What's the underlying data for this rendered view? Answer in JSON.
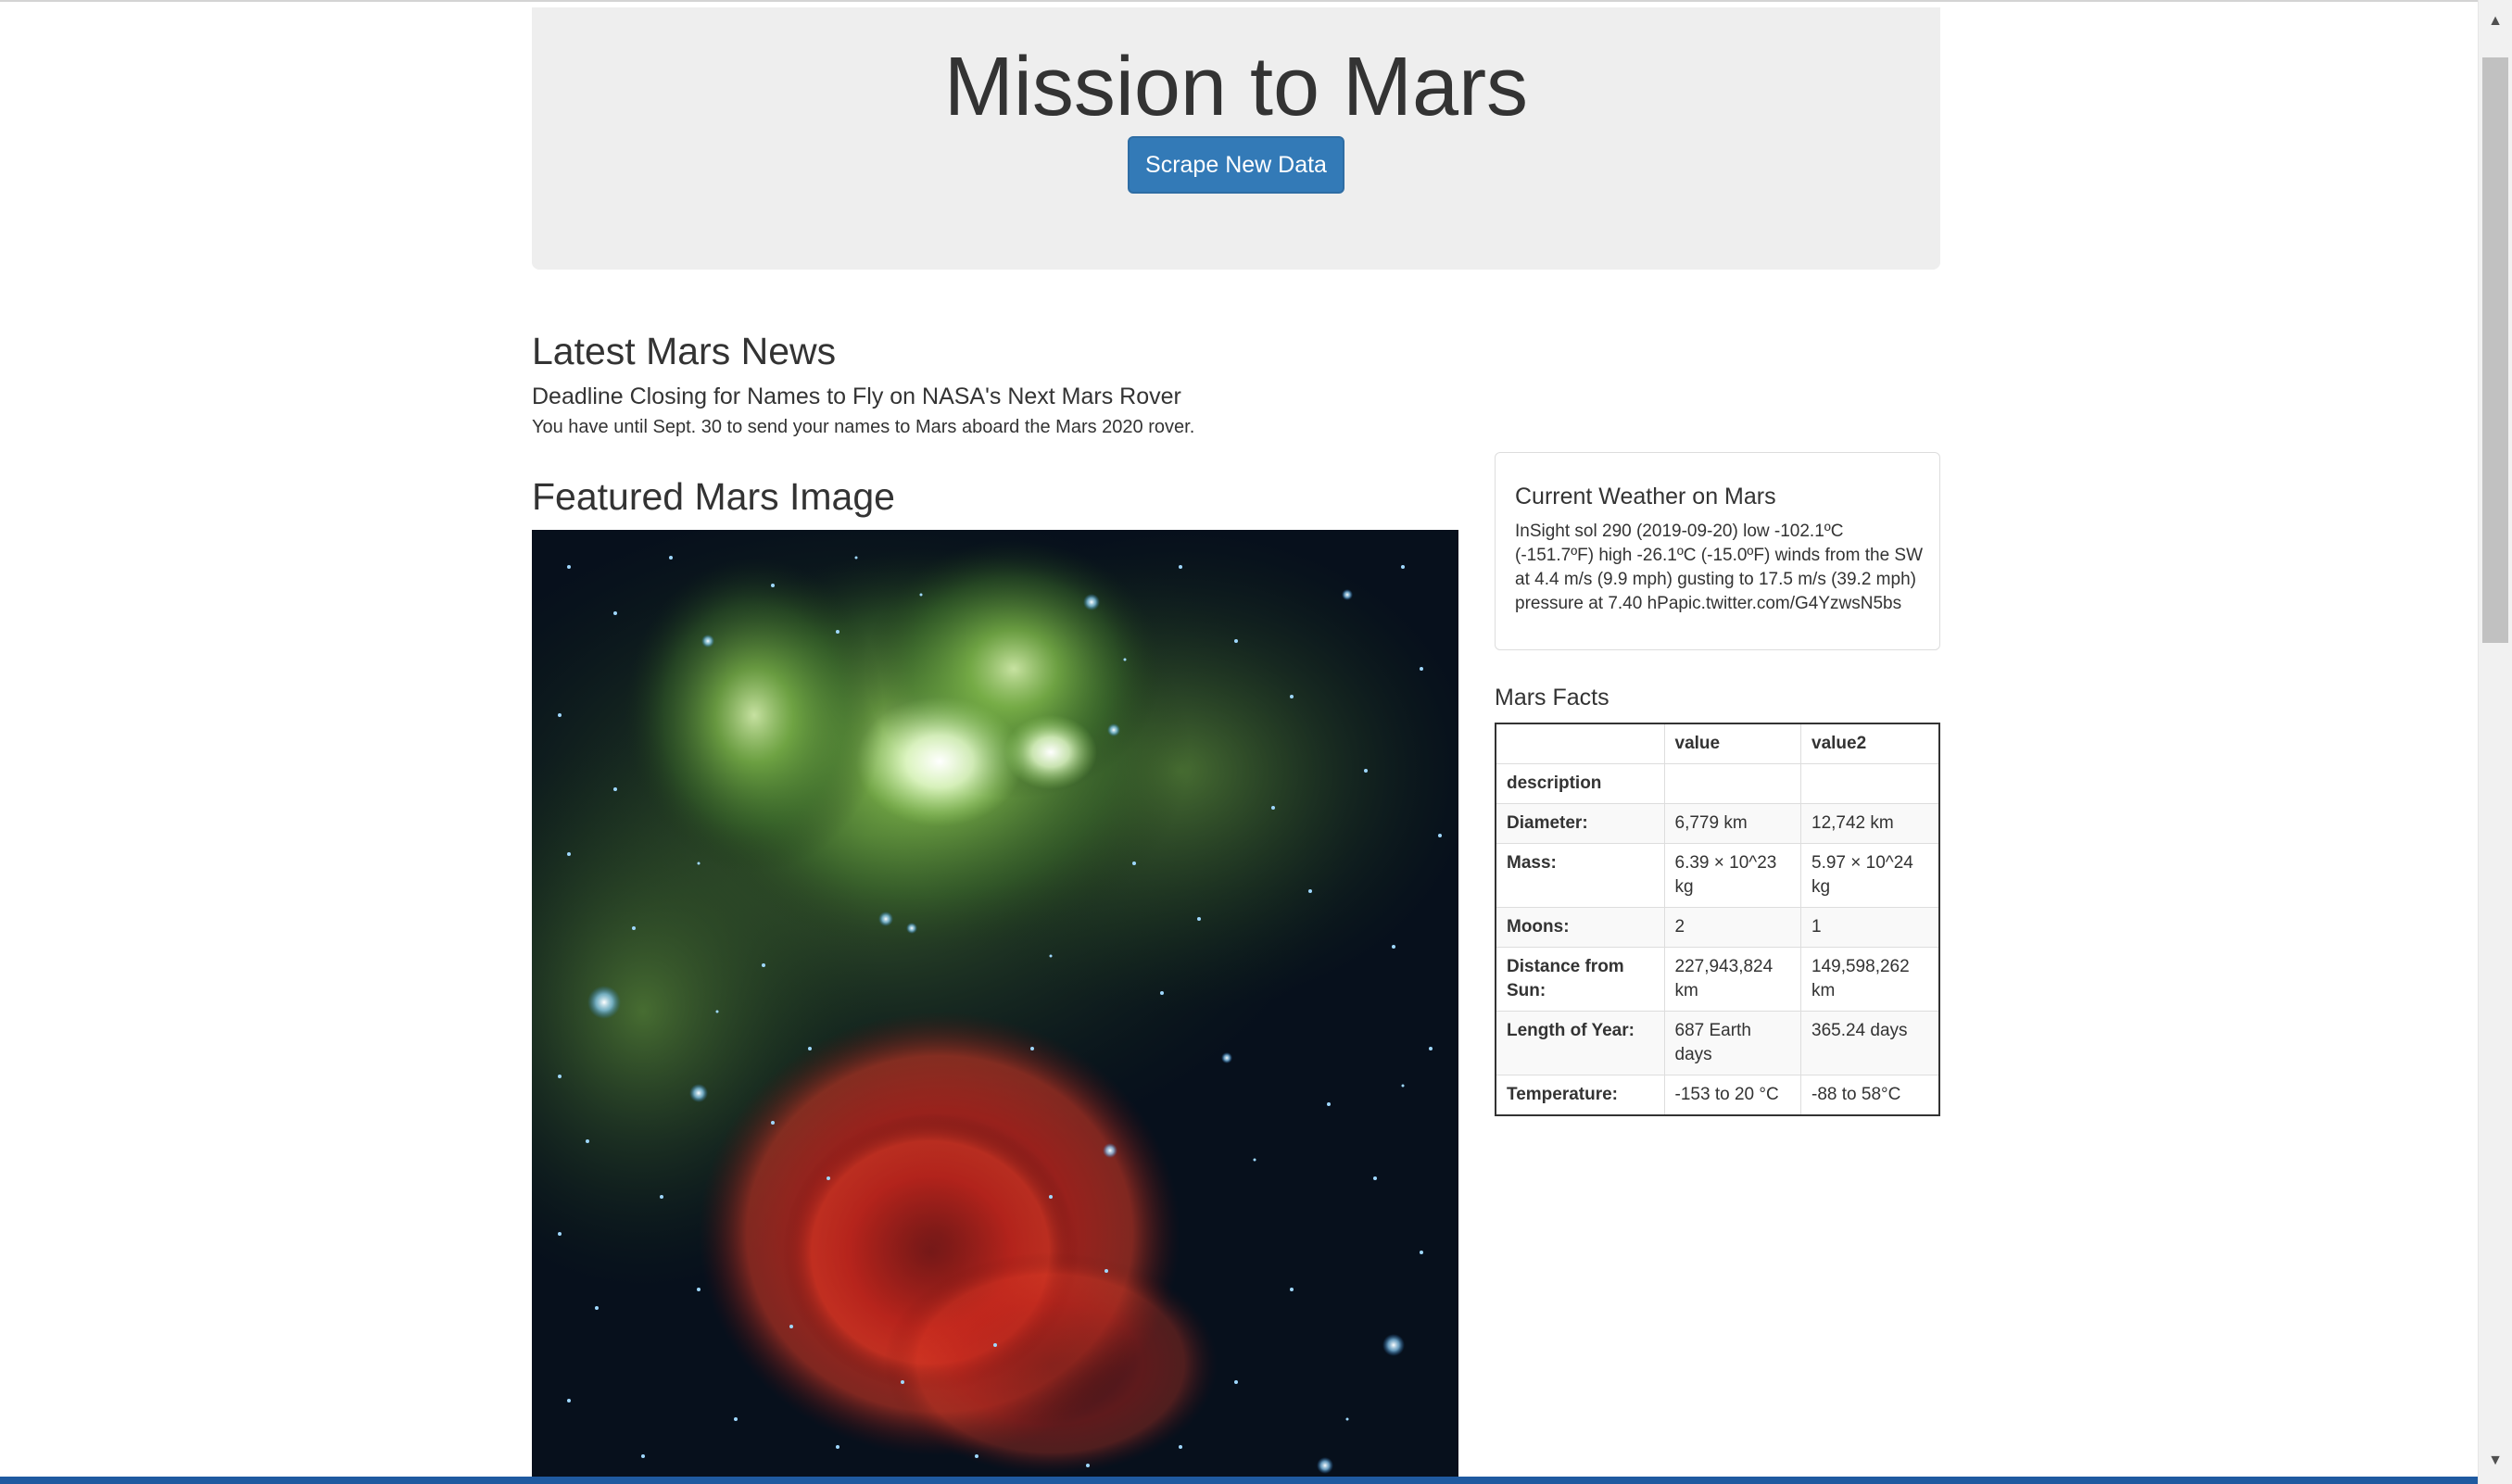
{
  "header": {
    "title": "Mission to Mars",
    "scrape_button_label": "Scrape New Data"
  },
  "news": {
    "section_title": "Latest Mars News",
    "headline": "Deadline Closing for Names to Fly on NASA's Next Mars Rover",
    "teaser": "You have until Sept. 30 to send your names to Mars aboard the Mars 2020 rover."
  },
  "featured": {
    "section_title": "Featured Mars Image"
  },
  "weather": {
    "title": "Current Weather on Mars",
    "text": "InSight sol 290 (2019-09-20) low -102.1ºC (-151.7ºF) high -26.1ºC (-15.0ºF) winds from the SW at 4.4 m/s (9.9 mph) gusting to 17.5 m/s (39.2 mph) pressure at 7.40 hPapic.twitter.com/G4YzwsN5bs"
  },
  "facts": {
    "title": "Mars Facts",
    "headers": [
      "",
      "value",
      "value2"
    ],
    "index_label": "description",
    "rows": [
      {
        "label": "Diameter:",
        "value": "6,779 km",
        "value2": "12,742 km"
      },
      {
        "label": "Mass:",
        "value": "6.39 × 10^23 kg",
        "value2": "5.97 × 10^24 kg"
      },
      {
        "label": "Moons:",
        "value": "2",
        "value2": "1"
      },
      {
        "label": "Distance from Sun:",
        "value": "227,943,824 km",
        "value2": "149,598,262 km"
      },
      {
        "label": "Length of Year:",
        "value": "687 Earth days",
        "value2": "365.24 days"
      },
      {
        "label": "Temperature:",
        "value": "-153 to 20 °C",
        "value2": "-88 to 58°C"
      }
    ]
  },
  "scrollbar": {
    "up_icon": "scroll-up-arrow-icon",
    "down_icon": "scroll-down-arrow-icon"
  },
  "colors": {
    "button": "#337ab7",
    "jumbotron_bg": "#eeeeee",
    "text": "#333333"
  }
}
